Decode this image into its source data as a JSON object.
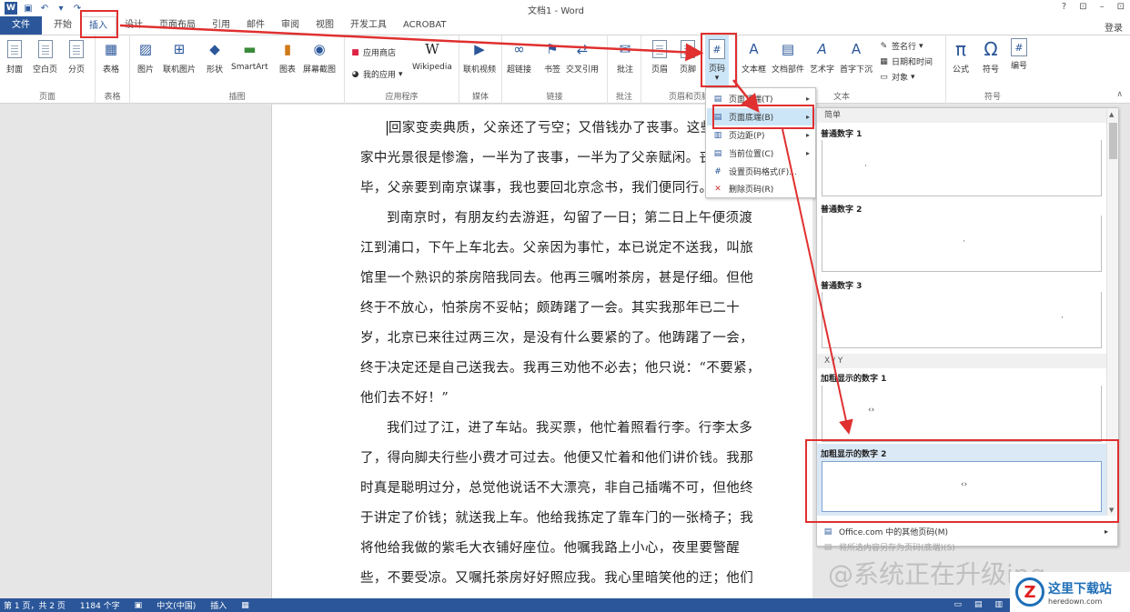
{
  "window": {
    "title": "文档1 - Word",
    "controls": [
      "?",
      "⊡",
      "–",
      "⊡"
    ],
    "login": "登录"
  },
  "tabs": [
    "文件",
    "开始",
    "插入",
    "设计",
    "页面布局",
    "引用",
    "邮件",
    "审阅",
    "视图",
    "开发工具",
    "ACROBAT"
  ],
  "active_tab": "插入",
  "ribbon": {
    "groups": [
      {
        "label": "页面",
        "buttons": [
          "封面",
          "空白页",
          "分页"
        ]
      },
      {
        "label": "表格",
        "buttons": [
          "表格"
        ]
      },
      {
        "label": "插图",
        "buttons": [
          "图片",
          "联机图片",
          "形状",
          "SmartArt",
          "图表",
          "屏幕截图"
        ]
      },
      {
        "label": "应用程序",
        "buttons": [
          "应用商店",
          "我的应用",
          "Wikipedia"
        ]
      },
      {
        "label": "媒体",
        "buttons": [
          "联机视频"
        ]
      },
      {
        "label": "链接",
        "buttons": [
          "超链接",
          "书签",
          "交叉引用"
        ]
      },
      {
        "label": "批注",
        "buttons": [
          "批注"
        ]
      },
      {
        "label": "页眉和页脚",
        "buttons": [
          "页眉",
          "页脚",
          "页码"
        ]
      },
      {
        "label": "文本",
        "buttons": [
          "文本框",
          "文档部件",
          "艺术字",
          "首字下沉",
          "签名行",
          "日期和时间",
          "对象"
        ]
      },
      {
        "label": "符号",
        "buttons": [
          "公式",
          "符号",
          "编号"
        ]
      }
    ]
  },
  "page_number_menu": {
    "items": [
      {
        "label": "页面顶端(T)",
        "has_submenu": true
      },
      {
        "label": "页面底端(B)",
        "has_submenu": true,
        "highlighted": true
      },
      {
        "label": "页边距(P)",
        "has_submenu": true
      },
      {
        "label": "当前位置(C)",
        "has_submenu": true
      },
      {
        "label": "设置页码格式(F)...",
        "has_submenu": false
      },
      {
        "label": "删除页码(R)",
        "has_submenu": false
      }
    ]
  },
  "gallery": {
    "sections": [
      {
        "header": "简单",
        "items": [
          "普通数字 1",
          "普通数字 2",
          "普通数字 3"
        ]
      },
      {
        "header": "X / Y",
        "items": [
          "加粗显示的数字 1",
          "加粗显示的数字 2"
        ]
      }
    ],
    "selected": "加粗显示的数字 2",
    "footer": [
      "Office.com 中的其他页码(M)",
      "将所选内容另存为页码(底端)(S)"
    ]
  },
  "document": {
    "paragraphs": [
      "回家变卖典质，父亲还了亏空；又借钱办了丧事。这些日子，家中光景很是惨澹，一半为了丧事，一半为了父亲赋闲。丧事完毕，父亲要到南京谋事，我也要回北京念书，我们便同行。",
      "到南京时，有朋友约去游逛，勾留了一日；第二日上午便须渡江到浦口，下午上车北去。父亲因为事忙，本已说定不送我，叫旅馆里一个熟识的茶房陪我同去。他再三嘱咐茶房，甚是仔细。但他终于不放心，怕茶房不妥帖；颇踌躇了一会。其实我那年已二十岁，北京已来往过两三次，是没有什么要紧的了。他踌躇了一会，终于决定还是自己送我去。我再三劝他不必去；他只说：“不要紧，他们去不好！”",
      "我们过了江，进了车站。我买票，他忙着照看行李。行李太多了，得向脚夫行些小费才可过去。他便又忙着和他们讲价钱。我那时真是聪明过分，总觉他说话不大漂亮，非自己插嘴不可，但他终于讲定了价钱；就送我上车。他给我拣定了靠车门的一张椅子；我将他给我做的紫毛大衣铺好座位。他嘱我路上小心，夜里要警醒些，不要受凉。又嘱托茶房好好照应我。我心里暗笑他的迂；他们"
    ]
  },
  "statusbar": {
    "page": "第 1 页，共 2 页",
    "words": "1184 个字",
    "lang": "中文(中国)",
    "mode": "插入"
  },
  "watermark": "@系统正在升级ing",
  "brand": {
    "name": "这里下载站",
    "url": "heredown.com"
  }
}
